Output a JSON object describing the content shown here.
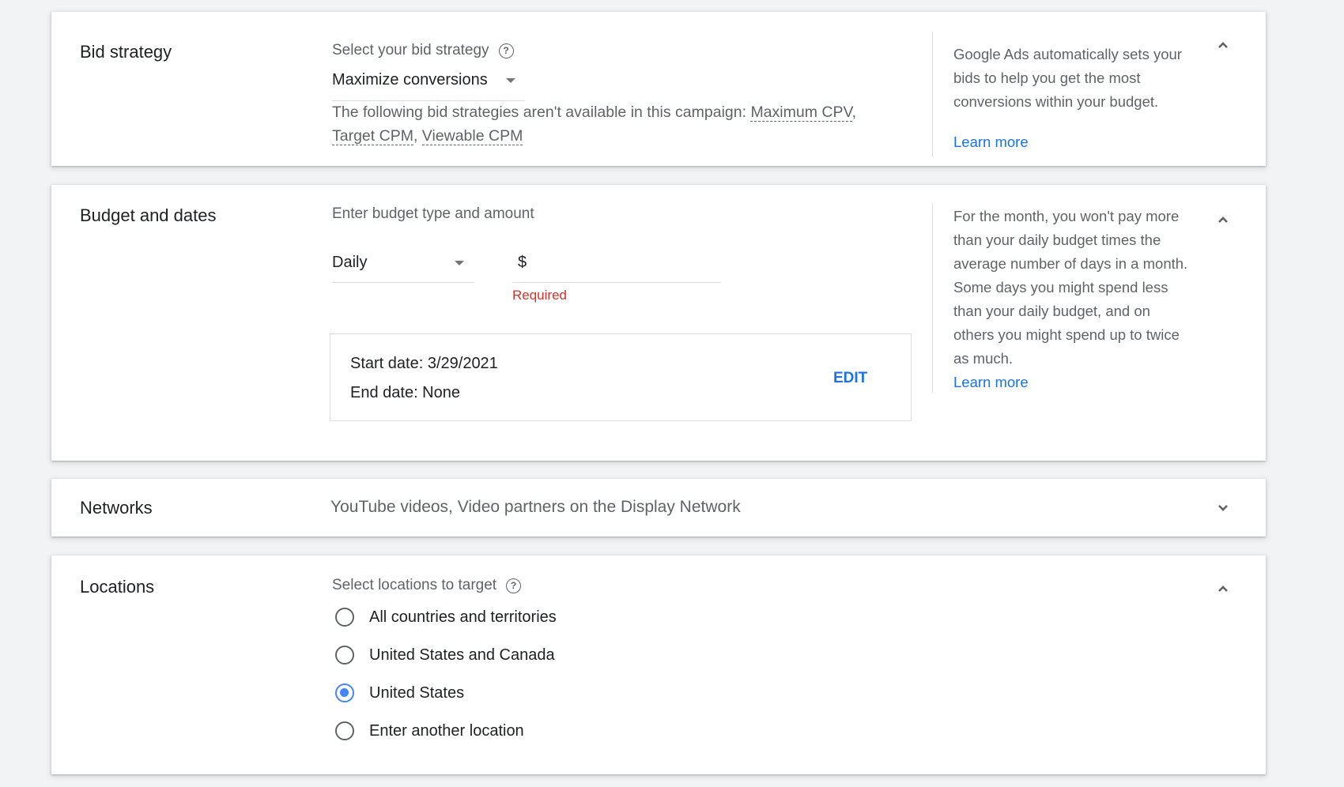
{
  "bid_strategy": {
    "title": "Bid strategy",
    "select_label": "Select your bid strategy",
    "help_icon": "help-circle-icon",
    "selected": "Maximize conversions",
    "unavailable_prefix": "The following bid strategies aren't available in this campaign:",
    "unavailable": [
      "Maximum CPV",
      "Target CPM",
      "Viewable CPM"
    ],
    "side_text": "Google Ads automatically sets your bids to help you get the most conversions within your budget.",
    "learn_more": "Learn more",
    "expanded": true
  },
  "budget": {
    "title": "Budget and dates",
    "label": "Enter budget type and amount",
    "type_selected": "Daily",
    "currency_symbol": "$",
    "amount_value": "",
    "error": "Required",
    "start_date": "Start date: 3/29/2021",
    "end_date": "End date: None",
    "edit_label": "EDIT",
    "side_text": "For the month, you won't pay more than your daily budget times the average number of days in a month. Some days you might spend less than your daily budget, and on others you might spend up to twice as much.",
    "learn_more": "Learn more",
    "expanded": true
  },
  "networks": {
    "title": "Networks",
    "summary": "YouTube videos, Video partners on the Display Network",
    "expanded": false
  },
  "locations": {
    "title": "Locations",
    "label": "Select locations to target",
    "help_icon": "help-circle-icon",
    "options": [
      {
        "label": "All countries and territories",
        "checked": false
      },
      {
        "label": "United States and Canada",
        "checked": false
      },
      {
        "label": "United States",
        "checked": true
      },
      {
        "label": "Enter another location",
        "checked": false
      }
    ],
    "expanded": true
  },
  "colors": {
    "accent": "#1a73e8",
    "radio_checked": "#4285f4",
    "error": "#d93025",
    "background": "#f1f3f4"
  }
}
